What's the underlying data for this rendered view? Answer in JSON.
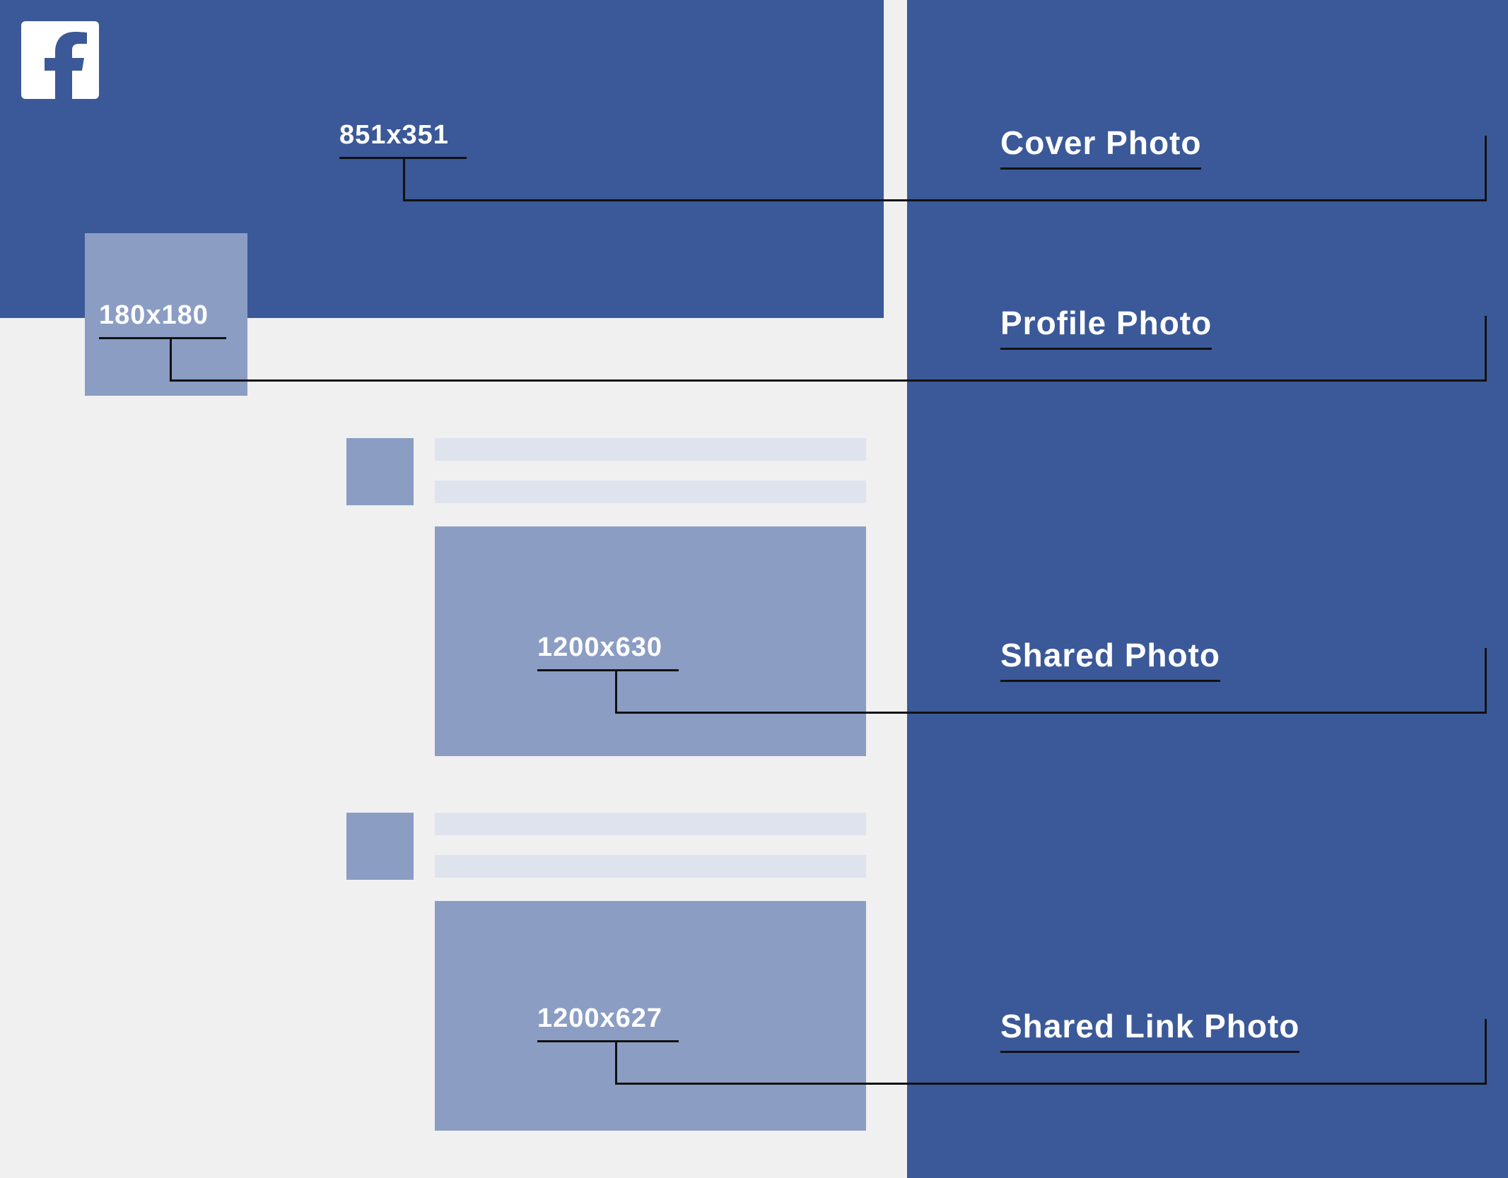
{
  "platform": "Facebook",
  "colors": {
    "primary": "#3b5998",
    "secondary": "#8b9dc3",
    "placeholder": "#dfe3ee",
    "background": "#f0f0f0"
  },
  "items": [
    {
      "key": "cover",
      "dimension": "851x351",
      "label": "Cover Photo"
    },
    {
      "key": "profile",
      "dimension": "180x180",
      "label": "Profile Photo"
    },
    {
      "key": "shared",
      "dimension": "1200x630",
      "label": "Shared Photo"
    },
    {
      "key": "shared_link",
      "dimension": "1200x627",
      "label": "Shared Link Photo"
    }
  ]
}
